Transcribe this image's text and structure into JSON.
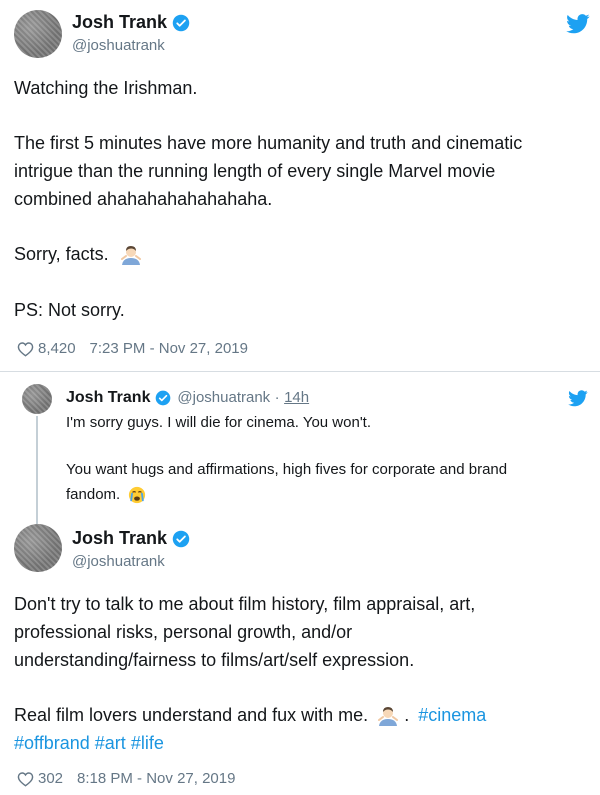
{
  "tweet1": {
    "name": "Josh Trank",
    "handle": "@joshuatrank",
    "lines": [
      "Watching the Irishman.",
      "The first 5 minutes have more humanity and truth and cinematic",
      "intrigue than the running length of every single Marvel movie",
      "combined ahahahahahahahaha.",
      "Sorry, facts.",
      "PS: Not sorry."
    ],
    "likes": "8,420",
    "timestamp": "7:23 PM - Nov 27, 2019",
    "icons": {
      "verified": "verified-badge-icon",
      "logo": "twitter-bird-icon",
      "like": "heart-icon",
      "emoji": "man-shrugging-emoji"
    }
  },
  "quoted": {
    "name": "Josh Trank",
    "handle": "@joshuatrank",
    "separator": "·",
    "age": "14h",
    "lines": [
      "I'm sorry guys. I will die for cinema. You won't.",
      "You want hugs and affirmations, high fives for corporate and brand",
      "fandom."
    ],
    "icons": {
      "emoji": "crying-face-emoji"
    }
  },
  "tweet2": {
    "name": "Josh Trank",
    "handle": "@joshuatrank",
    "lines": [
      "Don't try to talk to me about film history, film appraisal, art,",
      "professional risks, personal growth, and/or",
      "understanding/fairness to films/art/self expression.",
      "Real film lovers understand and fux with me."
    ],
    "after_emoji": ".",
    "hashtags": [
      "#cinema",
      "#offbrand",
      "#art",
      "#life"
    ],
    "likes": "302",
    "timestamp": "8:18 PM - Nov 27, 2019"
  },
  "colors": {
    "link": "#1b95e0",
    "muted": "#657786",
    "text": "#14171a",
    "divider": "#d7dde2"
  }
}
